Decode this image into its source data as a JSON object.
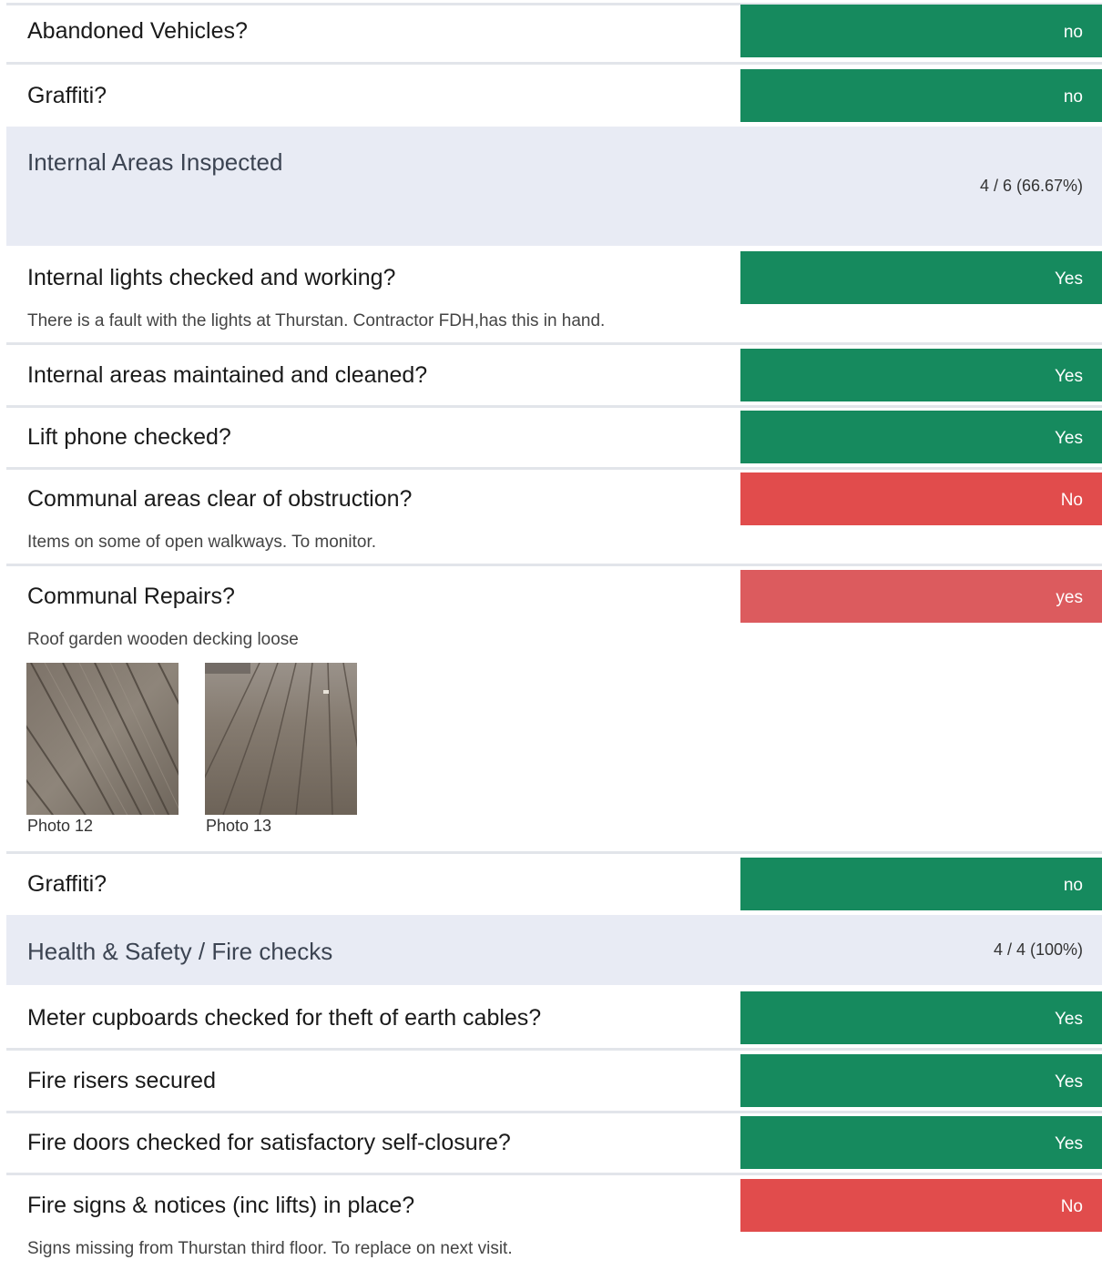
{
  "items_a": [
    {
      "label": "Abandoned Vehicles?",
      "answer": "no",
      "color": "#168a5e"
    },
    {
      "label": "Graffiti?",
      "answer": "no",
      "color": "#168a5e"
    }
  ],
  "section_internal": {
    "title": "Internal Areas Inspected",
    "score": "4 / 6 (66.67%)"
  },
  "items_b": [
    {
      "label": "Internal lights checked and working?",
      "answer": "Yes",
      "note": "There is a fault with the lights at Thurstan.  Contractor FDH,has this in hand."
    },
    {
      "label": "Internal areas maintained and cleaned?",
      "answer": "Yes"
    },
    {
      "label": "Lift phone checked?",
      "answer": "Yes"
    },
    {
      "label": "Communal areas clear of obstruction?",
      "answer": "No",
      "note": "Items on some of open walkways.  To monitor."
    },
    {
      "label": "Communal Repairs?",
      "answer": "yes",
      "note": "Roof garden wooden decking loose"
    },
    {
      "label": "Graffiti?",
      "answer": "no"
    }
  ],
  "photos": [
    {
      "caption": "Photo 12",
      "icon": "decking-photo"
    },
    {
      "caption": "Photo 13",
      "icon": "decking-photo"
    }
  ],
  "section_fire": {
    "title": "Health & Safety / Fire checks",
    "score": "4 / 4 (100%)"
  },
  "items_c": [
    {
      "label": "Meter cupboards checked for theft of earth cables?",
      "answer": "Yes"
    },
    {
      "label": "Fire risers secured",
      "answer": "Yes"
    },
    {
      "label": "Fire doors checked for satisfactory self-closure?",
      "answer": "Yes"
    },
    {
      "label": "Fire signs & notices (inc lifts) in place?",
      "answer": "No",
      "note": "Signs missing from Thurstan third floor.  To replace on next visit."
    }
  ],
  "colors": {
    "green": "#168a5e",
    "red": "#e14c4c",
    "light_red": "#dc5b5e",
    "section_bg": "#e8ebf4"
  }
}
